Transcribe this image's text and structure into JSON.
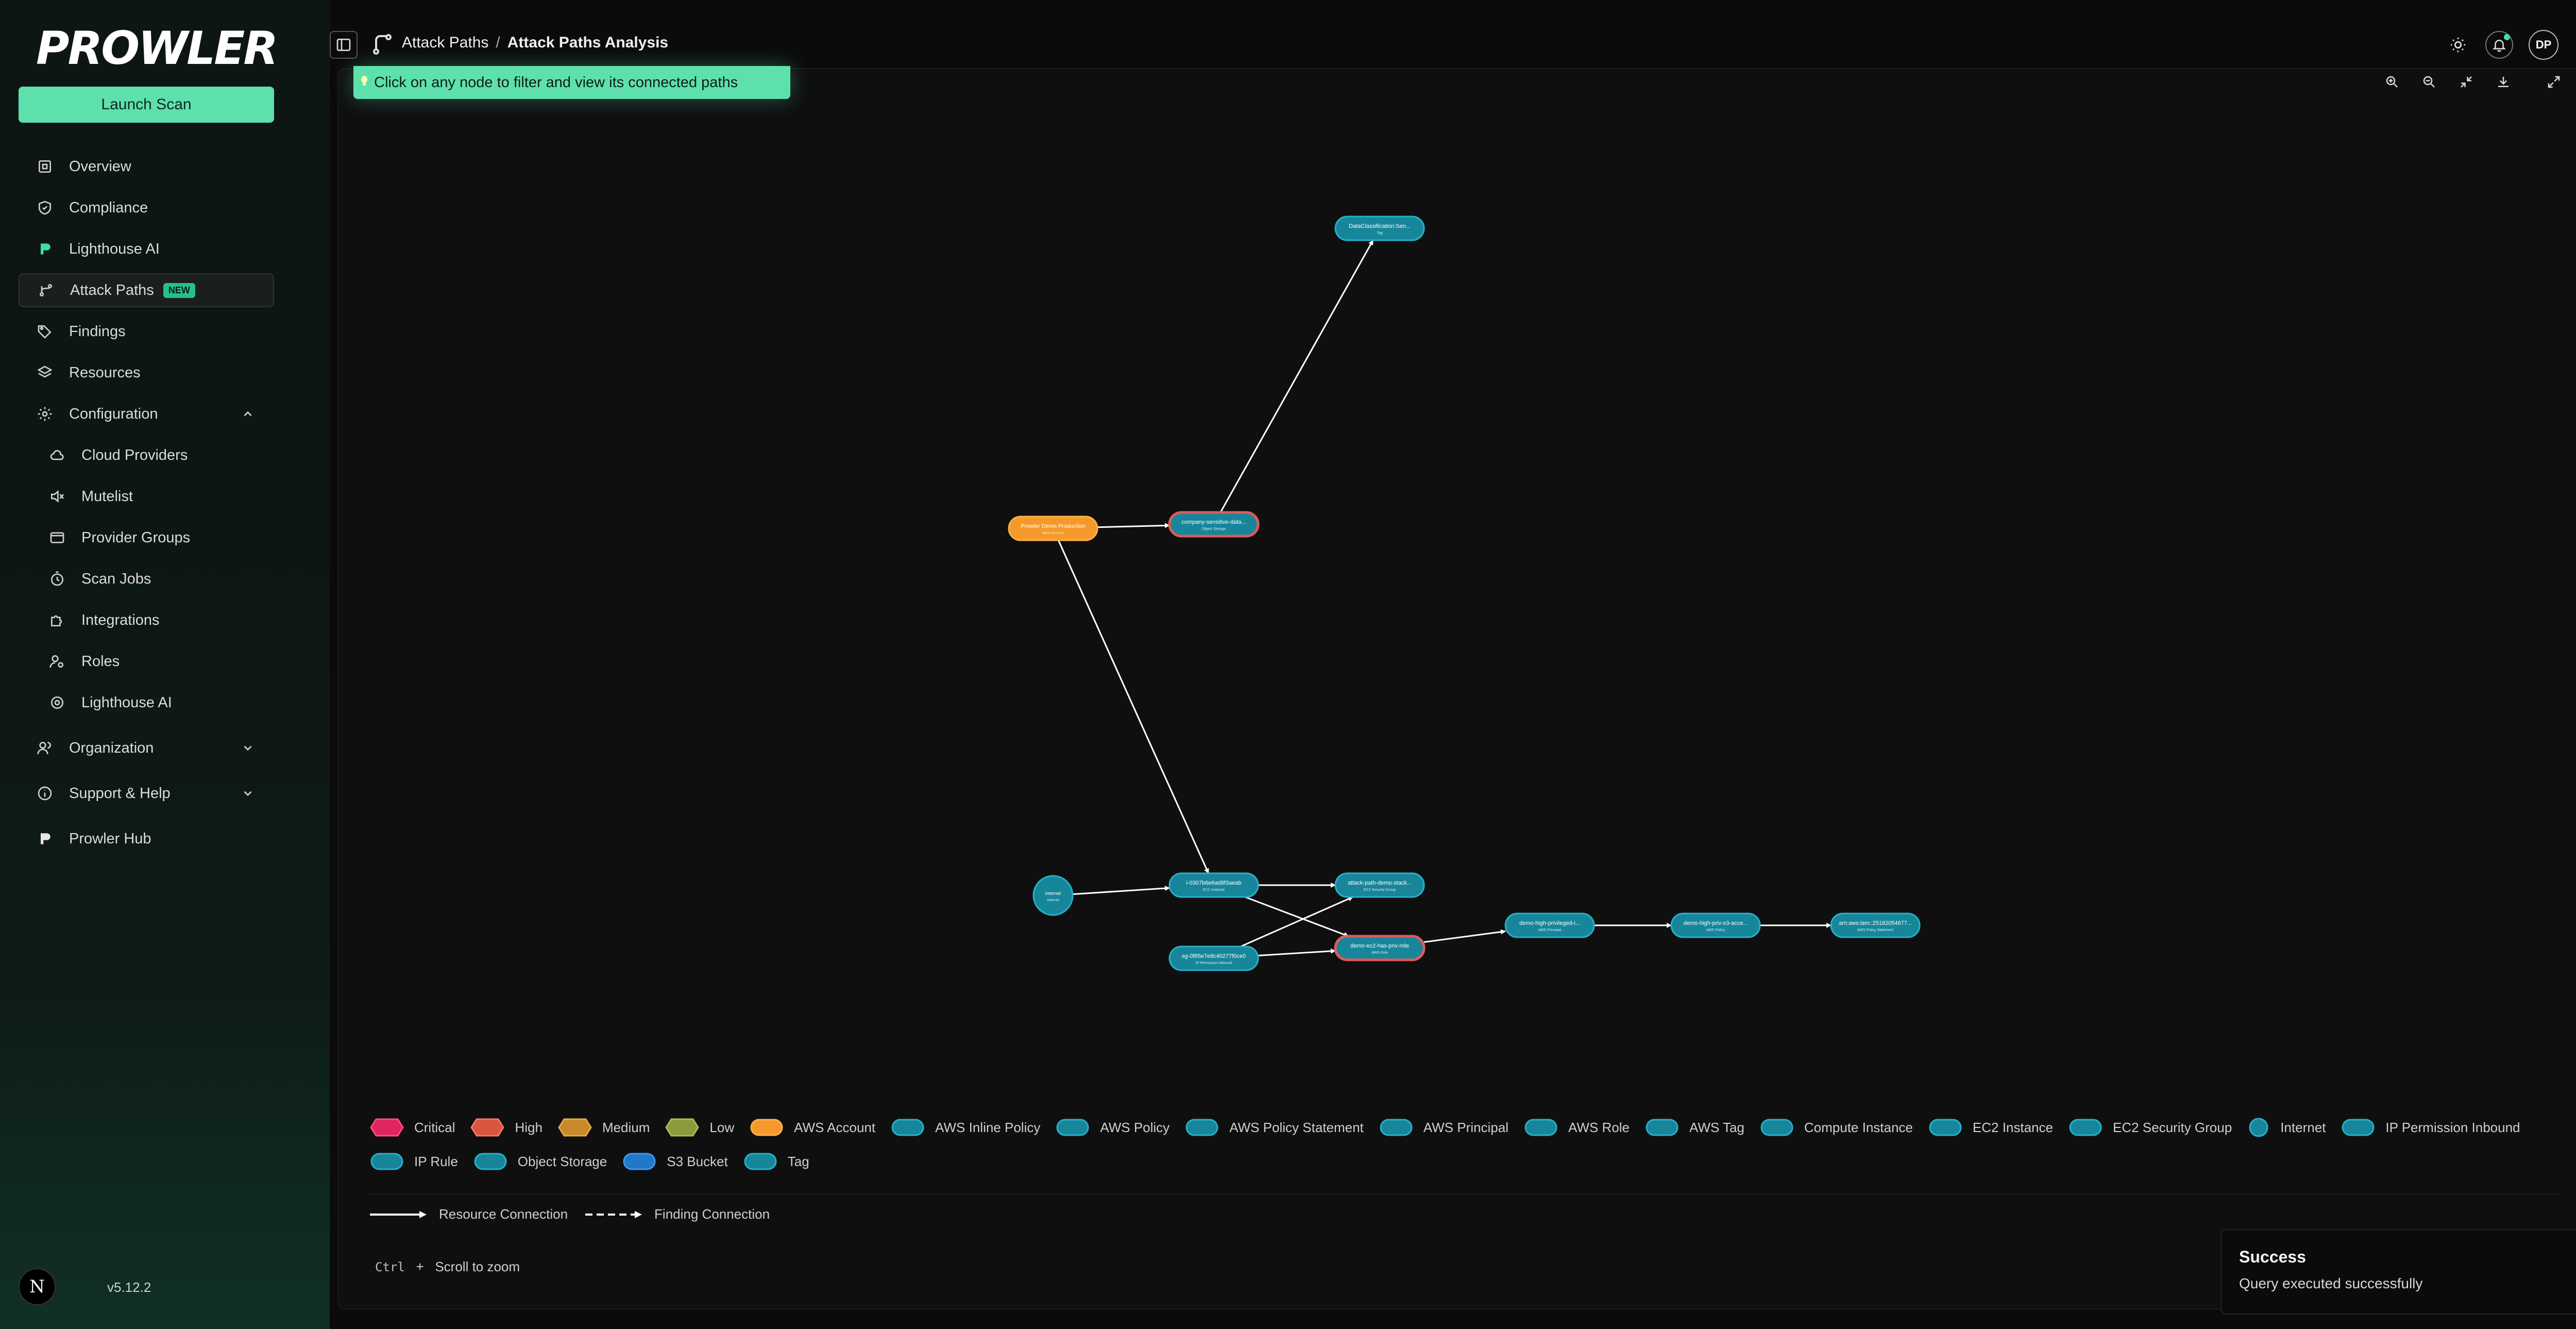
{
  "brand": {
    "logo_text": "PROWLER"
  },
  "sidebar": {
    "launch_label": "Launch Scan",
    "items": [
      {
        "label": "Overview"
      },
      {
        "label": "Compliance"
      },
      {
        "label": "Lighthouse AI"
      },
      {
        "label": "Attack Paths",
        "badge": "NEW"
      },
      {
        "label": "Findings"
      },
      {
        "label": "Resources"
      },
      {
        "label": "Configuration"
      },
      {
        "label": "Cloud Providers"
      },
      {
        "label": "Mutelist"
      },
      {
        "label": "Provider Groups"
      },
      {
        "label": "Scan Jobs"
      },
      {
        "label": "Integrations"
      },
      {
        "label": "Roles"
      },
      {
        "label": "Lighthouse AI"
      },
      {
        "label": "Organization"
      },
      {
        "label": "Support & Help"
      },
      {
        "label": "Prowler Hub"
      }
    ],
    "version": "v5.12.2",
    "n_logo": "N"
  },
  "header": {
    "breadcrumb": [
      "Attack Paths",
      "Attack Paths Analysis"
    ],
    "separator": "/",
    "avatar": "DP"
  },
  "hint": "Click on any node to filter and view its connected paths",
  "graph": {
    "nodes": [
      {
        "id": "n1",
        "label": "DataClassification:Sen...",
        "sub": "Tag",
        "type": "tag"
      },
      {
        "id": "n2",
        "label": "Prowler Demo Production",
        "sub": "AWS Account",
        "type": "account"
      },
      {
        "id": "n3",
        "label": "company-sensitive-data...",
        "sub": "Object Storage",
        "type": "storage_high"
      },
      {
        "id": "n4",
        "label": "Internet",
        "sub": "Internet",
        "type": "internet"
      },
      {
        "id": "n5",
        "label": "i-0307b6e6ad8f3aeab",
        "sub": "EC2 Instance",
        "type": "default"
      },
      {
        "id": "n6",
        "label": "sg-0f85e7e8c40277f0ce0",
        "sub": "IP Permission Inbound",
        "type": "default"
      },
      {
        "id": "n7",
        "label": "attack-path-demo-stack...",
        "sub": "EC2 Security Group",
        "type": "default"
      },
      {
        "id": "n8",
        "label": "demo-ec2-has-priv-role",
        "sub": "AWS Role",
        "type": "role_high"
      },
      {
        "id": "n9",
        "label": "demo-high-privileged-i...",
        "sub": "AWS Principal",
        "type": "default"
      },
      {
        "id": "n10",
        "label": "demo-high-priv-s3-acce...",
        "sub": "AWS Policy",
        "type": "default"
      },
      {
        "id": "n11",
        "label": "arn:aws:iam::25182054677...",
        "sub": "AWS Policy Statement",
        "type": "default"
      }
    ],
    "edges": [
      [
        "n2",
        "n3"
      ],
      [
        "n3",
        "n1"
      ],
      [
        "n2",
        "n5"
      ],
      [
        "n4",
        "n5"
      ],
      [
        "n5",
        "n7"
      ],
      [
        "n5",
        "n8"
      ],
      [
        "n6",
        "n7"
      ],
      [
        "n6",
        "n8"
      ],
      [
        "n8",
        "n9"
      ],
      [
        "n9",
        "n10"
      ],
      [
        "n10",
        "n11"
      ]
    ]
  },
  "legend": [
    {
      "label": "Critical",
      "shape": "hex",
      "fill": "#e0245e",
      "stroke": "#ff4d7d"
    },
    {
      "label": "High",
      "shape": "hex",
      "fill": "#d9553f",
      "stroke": "#f07a62"
    },
    {
      "label": "Medium",
      "shape": "hex",
      "fill": "#c8892a",
      "stroke": "#e9a946"
    },
    {
      "label": "Low",
      "shape": "hex",
      "fill": "#8a9a3c",
      "stroke": "#a9bb55"
    },
    {
      "label": "AWS Account",
      "shape": "pill",
      "fill": "#f59a2a",
      "stroke": "#ffb04a"
    },
    {
      "label": "AWS Inline Policy",
      "shape": "pill",
      "fill": "#17869a",
      "stroke": "#27b0c8"
    },
    {
      "label": "AWS Policy",
      "shape": "pill",
      "fill": "#17869a",
      "stroke": "#27b0c8"
    },
    {
      "label": "AWS Policy Statement",
      "shape": "pill",
      "fill": "#17869a",
      "stroke": "#27b0c8"
    },
    {
      "label": "AWS Principal",
      "shape": "pill",
      "fill": "#17869a",
      "stroke": "#27b0c8"
    },
    {
      "label": "AWS Role",
      "shape": "pill",
      "fill": "#17869a",
      "stroke": "#27b0c8"
    },
    {
      "label": "AWS Tag",
      "shape": "pill",
      "fill": "#17869a",
      "stroke": "#27b0c8"
    },
    {
      "label": "Compute Instance",
      "shape": "pill",
      "fill": "#17869a",
      "stroke": "#27b0c8"
    },
    {
      "label": "EC2 Instance",
      "shape": "pill",
      "fill": "#17869a",
      "stroke": "#27b0c8"
    },
    {
      "label": "EC2 Security Group",
      "shape": "pill",
      "fill": "#17869a",
      "stroke": "#27b0c8"
    },
    {
      "label": "Internet",
      "shape": "circle",
      "fill": "#17869a",
      "stroke": "#27b0c8"
    },
    {
      "label": "IP Permission Inbound",
      "shape": "pill",
      "fill": "#17869a",
      "stroke": "#27b0c8"
    },
    {
      "label": "IP Rule",
      "shape": "pill",
      "fill": "#17869a",
      "stroke": "#27b0c8"
    },
    {
      "label": "Object Storage",
      "shape": "pill",
      "fill": "#17869a",
      "stroke": "#27b0c8"
    },
    {
      "label": "S3 Bucket",
      "shape": "pill",
      "fill": "#1f78c8",
      "stroke": "#3a9bef"
    },
    {
      "label": "Tag",
      "shape": "pill",
      "fill": "#17869a",
      "stroke": "#27b0c8"
    }
  ],
  "connections": {
    "resource": "Resource Connection",
    "finding": "Finding Connection"
  },
  "zoom_hint": {
    "key": "Ctrl",
    "plus": "+",
    "text": "Scroll to zoom"
  },
  "toast": {
    "title": "Success",
    "message": "Query executed successfully"
  },
  "colors": {
    "accent": "#5ee0ad",
    "node_teal": "#17869a",
    "node_orange": "#f59a2a",
    "node_high_border": "#e05a5a"
  }
}
